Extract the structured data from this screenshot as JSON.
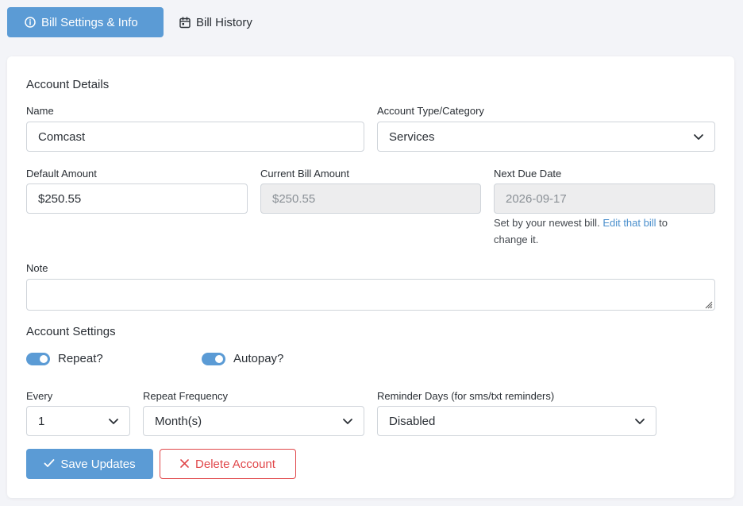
{
  "tabs": [
    {
      "label": "Bill Settings & Info",
      "icon": "info-circle-icon",
      "active": true
    },
    {
      "label": "Bill History",
      "icon": "calendar-icon",
      "active": false
    }
  ],
  "account_details": {
    "title": "Account Details",
    "name": {
      "label": "Name",
      "value": "Comcast"
    },
    "category": {
      "label": "Account Type/Category",
      "value": "Services"
    },
    "default_amount": {
      "label": "Default Amount",
      "value": "$250.55"
    },
    "current_bill_amount": {
      "label": "Current Bill Amount",
      "value": "$250.55"
    },
    "next_due_date": {
      "label": "Next Due Date",
      "value": "2026-09-17",
      "help_prefix": "Set by your newest bill.",
      "help_link": "Edit that bill",
      "help_suffix_1": "to",
      "help_suffix_2": "change it."
    },
    "note": {
      "label": "Note",
      "value": ""
    }
  },
  "account_settings": {
    "title": "Account Settings",
    "repeat": {
      "label": "Repeat?",
      "on": true
    },
    "autopay": {
      "label": "Autopay?",
      "on": true
    },
    "every": {
      "label": "Every",
      "value": "1"
    },
    "repeat_frequency": {
      "label": "Repeat Frequency",
      "value": "Month(s)"
    },
    "reminder_days": {
      "label": "Reminder Days (for sms/txt reminders)",
      "value": "Disabled"
    }
  },
  "actions": {
    "save": "Save Updates",
    "delete": "Delete Account"
  },
  "colors": {
    "primary": "#5b9bd5",
    "danger": "#e0474a",
    "link": "#4a8fcc"
  }
}
